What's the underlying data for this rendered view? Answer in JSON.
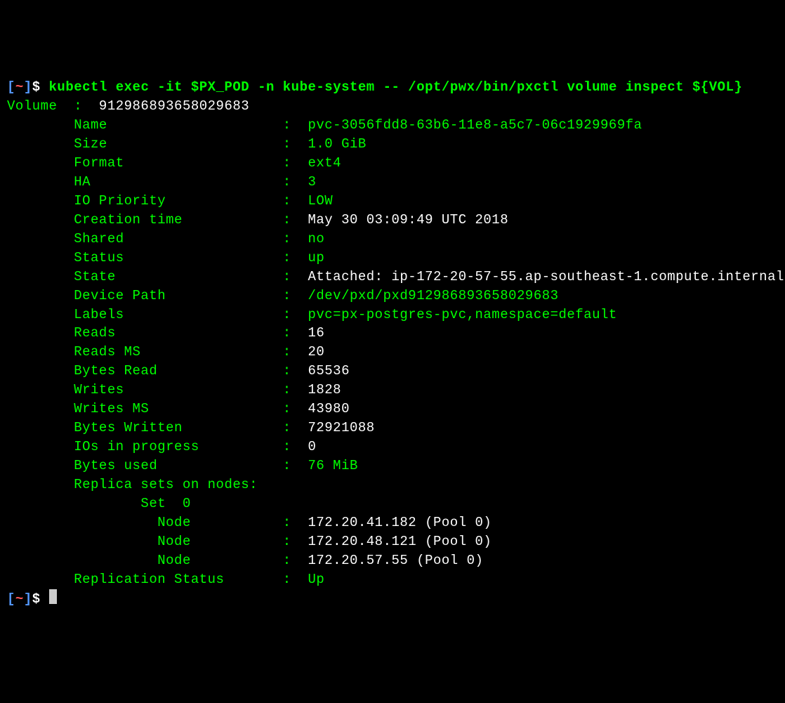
{
  "prompt": {
    "open": "[",
    "tilde": "~",
    "close": "]",
    "dollar": "$ "
  },
  "command": "kubectl exec -it $PX_POD -n kube-system -- /opt/pwx/bin/pxctl volume inspect ${VOL}",
  "volume_line": {
    "label": "Volume  :  ",
    "id": "912986893658029683"
  },
  "fields": [
    {
      "label": "        Name                     :  ",
      "value": "pvc-3056fdd8-63b6-11e8-a5c7-06c1929969fa",
      "vwhite": false
    },
    {
      "label": "        Size                     :  ",
      "value": "1.0 GiB",
      "vwhite": false
    },
    {
      "label": "        Format                   :  ",
      "value": "ext4",
      "vwhite": false
    },
    {
      "label": "        HA                       :  ",
      "value": "3",
      "vwhite": false
    },
    {
      "label": "        IO Priority              :  ",
      "value": "LOW",
      "vwhite": false
    },
    {
      "label": "        Creation time            :  ",
      "value": "May 30 03:09:49 UTC 2018",
      "vwhite": true
    },
    {
      "label": "        Shared                   :  ",
      "value": "no",
      "vwhite": false
    },
    {
      "label": "        Status                   :  ",
      "value": "up",
      "vwhite": false
    },
    {
      "label": "        State                    :  ",
      "value": "Attached: ip-172-20-57-55.ap-southeast-1.compute.internal",
      "vwhite": true
    },
    {
      "label": "        Device Path              :  ",
      "value": "/dev/pxd/pxd912986893658029683",
      "vwhite": false
    },
    {
      "label": "        Labels                   :  ",
      "value": "pvc=px-postgres-pvc,namespace=default",
      "vwhite": false
    },
    {
      "label": "        Reads                    :  ",
      "value": "16",
      "vwhite": true
    },
    {
      "label": "        Reads MS                 :  ",
      "value": "20",
      "vwhite": true
    },
    {
      "label": "        Bytes Read               :  ",
      "value": "65536",
      "vwhite": true
    },
    {
      "label": "        Writes                   :  ",
      "value": "1828",
      "vwhite": true
    },
    {
      "label": "        Writes MS                :  ",
      "value": "43980",
      "vwhite": true
    },
    {
      "label": "        Bytes Written            :  ",
      "value": "72921088",
      "vwhite": true
    },
    {
      "label": "        IOs in progress          :  ",
      "value": "0",
      "vwhite": true
    },
    {
      "label": "        Bytes used               :  ",
      "value": "76 MiB",
      "vwhite": false
    }
  ],
  "replica": {
    "header": "        Replica sets on nodes:",
    "set": "                Set  0",
    "nodes": [
      {
        "label": "                  Node           :  ",
        "value": "172.20.41.182 (Pool 0)"
      },
      {
        "label": "                  Node           :  ",
        "value": "172.20.48.121 (Pool 0)"
      },
      {
        "label": "                  Node           :  ",
        "value": "172.20.57.55 (Pool 0)"
      }
    ]
  },
  "rep_status": {
    "label": "        Replication Status       :  ",
    "value": "Up"
  }
}
